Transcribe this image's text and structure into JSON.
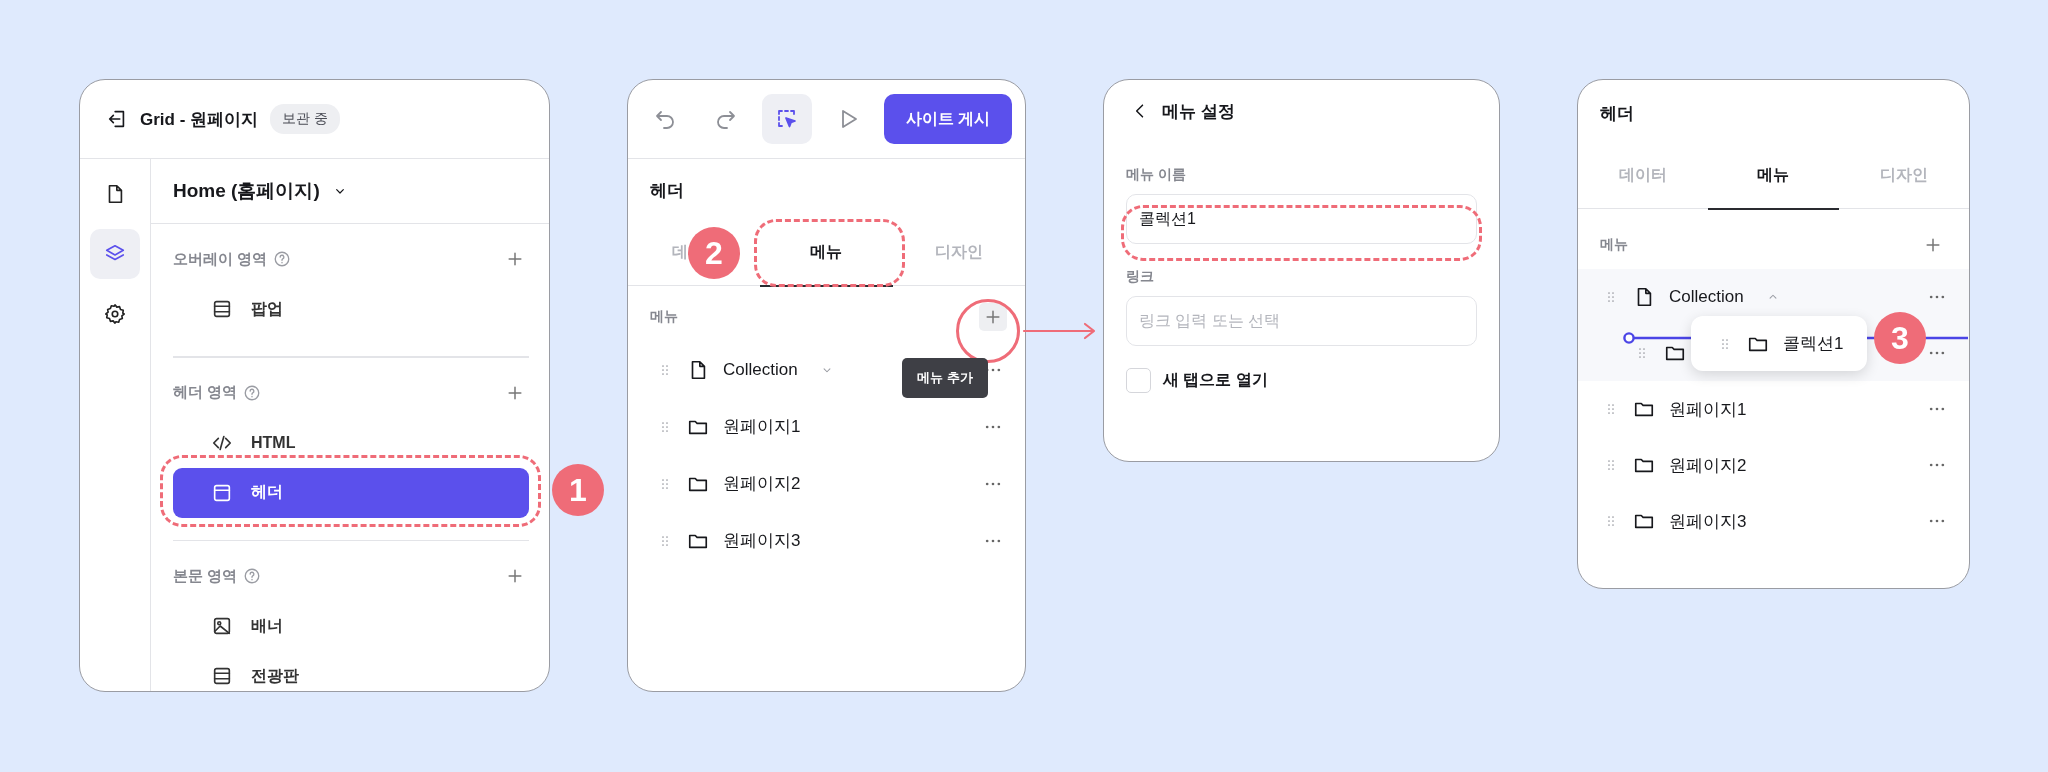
{
  "layers_panel": {
    "title": "Grid - 원페이지",
    "status_badge": "보관 중",
    "rail": [
      {
        "selected": false
      },
      {
        "selected": true
      },
      {
        "selected": false
      }
    ],
    "page_selector": "Home (홈페이지)",
    "sections": [
      {
        "title": "오버레이 영역",
        "items": [
          {
            "kind": "panel",
            "label": "팝업",
            "selected": false
          }
        ]
      },
      {
        "title": "헤더 영역",
        "items": [
          {
            "kind": "code",
            "label": "HTML",
            "selected": false
          },
          {
            "kind": "layout",
            "label": "헤더",
            "selected": true
          }
        ]
      },
      {
        "title": "본문 영역",
        "items": [
          {
            "kind": "image",
            "label": "배너",
            "selected": false
          },
          {
            "kind": "panel",
            "label": "전광판",
            "selected": false
          }
        ]
      }
    ],
    "step": "1"
  },
  "menu_panel": {
    "toolbar": [
      {
        "selected": false
      },
      {
        "selected": false
      },
      {
        "selected": true
      },
      {
        "selected": false
      }
    ],
    "publish_button": "사이트 게시",
    "title": "헤더",
    "tabs": [
      {
        "label": "데",
        "selected": false
      },
      {
        "label": "메뉴",
        "selected": true
      },
      {
        "label": "디자인",
        "selected": false
      }
    ],
    "section_label": "메뉴",
    "tooltip": "메뉴 추가",
    "items": [
      {
        "kind": "page",
        "label": "Collection",
        "expanded": false
      },
      {
        "kind": "folder",
        "label": "원페이지1"
      },
      {
        "kind": "folder",
        "label": "원페이지2"
      },
      {
        "kind": "folder",
        "label": "원페이지3"
      }
    ],
    "step": "2"
  },
  "menu_settings": {
    "title": "메뉴 설정",
    "name_label": "메뉴 이름",
    "name_value": "콜렉션1",
    "link_label": "링크",
    "link_placeholder": "링크 입력 또는 선택",
    "new_tab": {
      "label": "새 탭으로 열기",
      "checked": false
    }
  },
  "menu_drag_panel": {
    "title": "헤더",
    "tabs": [
      {
        "label": "데이터",
        "selected": false
      },
      {
        "label": "메뉴",
        "selected": true
      },
      {
        "label": "디자인",
        "selected": false
      }
    ],
    "section_label": "메뉴",
    "items": [
      {
        "kind": "page",
        "label": "Collection",
        "expanded": true,
        "children": [
          {
            "kind": "folder"
          }
        ]
      },
      {
        "kind": "folder",
        "label": "원페이지1"
      },
      {
        "kind": "folder",
        "label": "원페이지2"
      },
      {
        "kind": "folder",
        "label": "원페이지3"
      }
    ],
    "dragged_item": {
      "kind": "folder",
      "label": "콜렉션1"
    },
    "step": "3"
  }
}
